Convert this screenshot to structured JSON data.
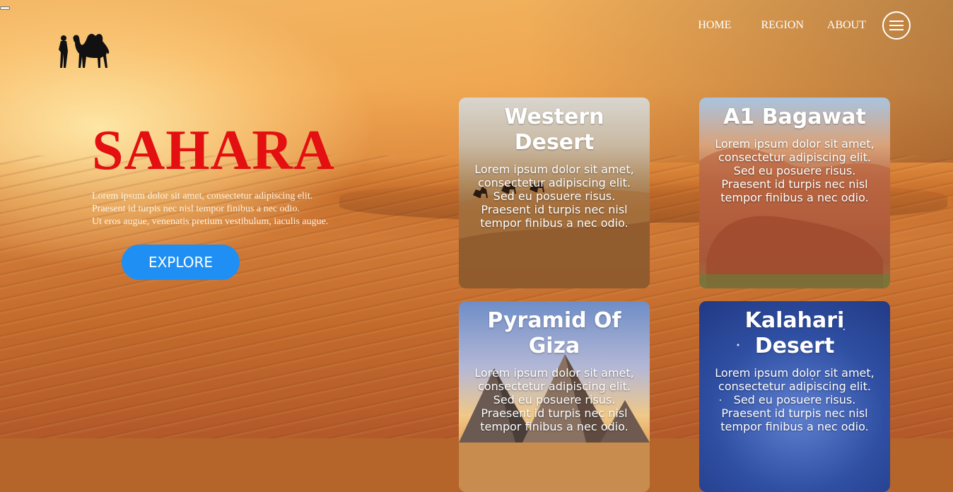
{
  "nav": {
    "home": "HOME",
    "region": "REGION",
    "about": "ABOUT"
  },
  "hero": {
    "title": "SAHARA",
    "description_lines": [
      "Lorem ipsum dolor sit amet, consectetur adipiscing elit.",
      "Praesent id turpis nec nisl tempor finibus a nec odio.",
      "Ut eros augue, venenatis pretium vestibulum, iaculis augue."
    ],
    "explore_label": "EXPLORE"
  },
  "cards": [
    {
      "title": "Western Desert",
      "text": "Lorem ipsum dolor sit amet, consectetur adipiscing elit. Sed eu posuere risus. Praesent id turpis nec nisl tempor finibus a nec odio."
    },
    {
      "title": "A1 Bagawat",
      "text": "Lorem ipsum dolor sit amet, consectetur adipiscing elit. Sed eu posuere risus. Praesent id turpis nec nisl tempor finibus a nec odio."
    },
    {
      "title": "Pyramid Of Giza",
      "text": "Lorem ipsum dolor sit amet, consectetur adipiscing elit. Sed eu posuere risus. Praesent id turpis nec nisl tempor finibus a nec odio."
    },
    {
      "title": "Kalahari Desert",
      "text": "Lorem ipsum dolor sit amet, consectetur adipiscing elit. Sed eu posuere risus. Praesent id turpis nec nisl tempor finibus a nec odio."
    }
  ],
  "colors": {
    "title": "#e30f10",
    "explore_button": "#1f8ff4"
  },
  "icons": {
    "logo": "camel-with-rider-icon",
    "menu": "hamburger-menu-icon"
  }
}
